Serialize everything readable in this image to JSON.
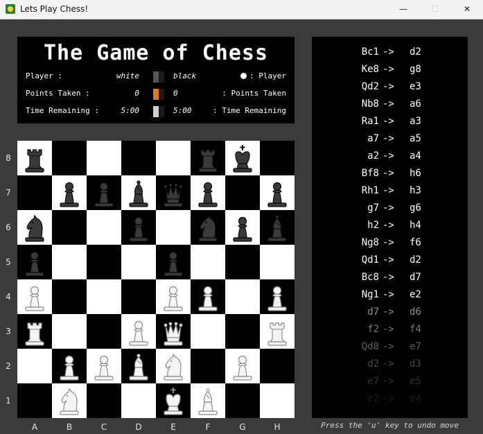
{
  "window": {
    "title": "Lets Play Chess!",
    "minimize": "—",
    "maximize": "☐",
    "close": "✕"
  },
  "info": {
    "title": "The Game of Chess",
    "player_row": {
      "left_label": "Player :",
      "white": "white",
      "black": "black",
      "right_label": ": Player"
    },
    "points_row": {
      "left_label": "Points Taken :",
      "white_value": "0",
      "black_value": "0",
      "right_label": ": Points Taken"
    },
    "time_row": {
      "left_label": "Time Remaining :",
      "white_value": "5:00",
      "black_value": "5:00",
      "right_label": ": Time Remaining"
    },
    "swatch_colors": {
      "player": "#555555",
      "points": "#e07a1f",
      "time": "#d0d0d0"
    }
  },
  "board": {
    "files": [
      "A",
      "B",
      "C",
      "D",
      "E",
      "F",
      "G",
      "H"
    ],
    "ranks": [
      "8",
      "7",
      "6",
      "5",
      "4",
      "3",
      "2",
      "1"
    ],
    "light_color": "#ffffff",
    "dark_color": "#000000",
    "position": [
      [
        "bR",
        "",
        "",
        "",
        "",
        "bR",
        "bK",
        ""
      ],
      [
        "",
        "bP",
        "bP",
        "bB",
        "bQ",
        "bP",
        "",
        "bP"
      ],
      [
        "bN",
        "",
        "",
        "bP",
        "",
        "bN",
        "bP",
        "bB"
      ],
      [
        "bP",
        "",
        "",
        "",
        "bP",
        "",
        "",
        ""
      ],
      [
        "wP",
        "",
        "",
        "",
        "wP",
        "wP",
        "",
        "wP"
      ],
      [
        "wR",
        "",
        "",
        "wP",
        "wQ",
        "",
        "",
        "wR"
      ],
      [
        "",
        "wP",
        "wP",
        "wB",
        "wN",
        "",
        "wP",
        ""
      ],
      [
        "",
        "wN",
        "",
        "",
        "wK",
        "wB",
        "",
        ""
      ]
    ]
  },
  "moves": [
    {
      "from": "Bc1",
      "to": "d2"
    },
    {
      "from": "Ke8",
      "to": "g8"
    },
    {
      "from": "Qd2",
      "to": "e3"
    },
    {
      "from": "Nb8",
      "to": "a6"
    },
    {
      "from": "Ra1",
      "to": "a3"
    },
    {
      "from": "a7",
      "to": "a5"
    },
    {
      "from": "a2",
      "to": "a4"
    },
    {
      "from": "Bf8",
      "to": "h6"
    },
    {
      "from": "Rh1",
      "to": "h3"
    },
    {
      "from": "g7",
      "to": "g6"
    },
    {
      "from": "h2",
      "to": "h4"
    },
    {
      "from": "Ng8",
      "to": "f6"
    },
    {
      "from": "Qd1",
      "to": "d2"
    },
    {
      "from": "Bc8",
      "to": "d7"
    },
    {
      "from": "Ng1",
      "to": "e2"
    },
    {
      "from": "d7",
      "to": "d6"
    },
    {
      "from": "f2",
      "to": "f4"
    },
    {
      "from": "Qd8",
      "to": "e7"
    },
    {
      "from": "d2",
      "to": "d3"
    },
    {
      "from": "e7",
      "to": "e5"
    },
    {
      "from": "e2",
      "to": "e4"
    }
  ],
  "move_arrow": "->",
  "undo_hint": "Press the 'u' key to undo move"
}
